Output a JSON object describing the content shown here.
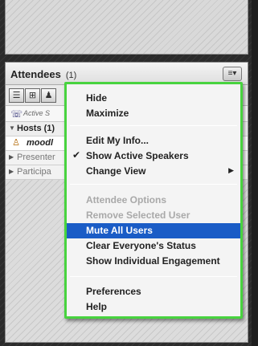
{
  "pod": {
    "title": "Attendees",
    "count": "(1)",
    "menu_button_glyph": "≡▾",
    "active_speakers": "Active S",
    "groups": [
      {
        "arrow": "▼",
        "label": "Hosts (1)"
      },
      {
        "arrow": "▶",
        "label": "Presenter"
      },
      {
        "arrow": "▶",
        "label": "Participa"
      }
    ],
    "host_user": "moodl"
  },
  "menu": {
    "items": [
      {
        "label": "Hide",
        "state": "normal"
      },
      {
        "label": "Maximize",
        "state": "normal"
      },
      {
        "label": "Edit My Info...",
        "state": "normal"
      },
      {
        "label": "Show Active Speakers",
        "state": "checked",
        "check": "✔"
      },
      {
        "label": "Change View",
        "state": "submenu",
        "sub": "▶"
      },
      {
        "label": "Attendee Options",
        "state": "disabled"
      },
      {
        "label": "Remove Selected User",
        "state": "disabled"
      },
      {
        "label": "Mute All Users",
        "state": "selected"
      },
      {
        "label": "Clear Everyone's Status",
        "state": "normal"
      },
      {
        "label": "Show Individual Engagement",
        "state": "normal"
      },
      {
        "label": "Preferences",
        "state": "normal"
      },
      {
        "label": "Help",
        "state": "normal"
      }
    ]
  },
  "colors": {
    "menu_border": "#48d33f",
    "selected_bg": "#1a5cc6"
  },
  "icons": {
    "list_view": "list-view-icon",
    "grid_view": "grid-view-icon",
    "user": "user-icon",
    "speaker": "speaker-icon"
  }
}
